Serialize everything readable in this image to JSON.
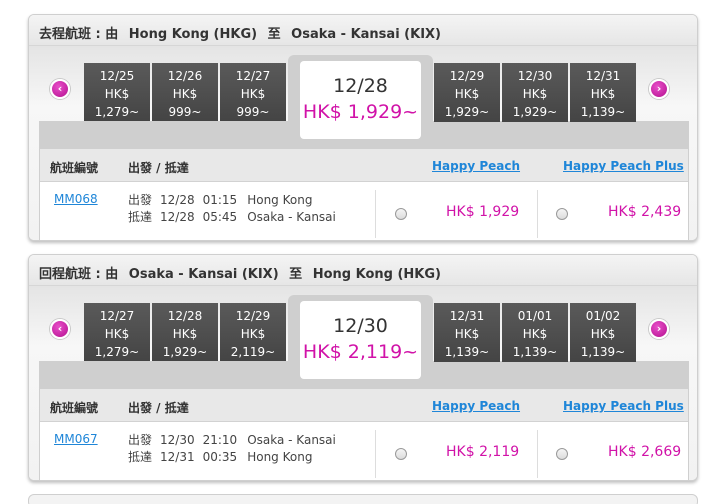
{
  "outbound": {
    "header": {
      "label": "去程航班 : 由",
      "from": "Hong Kong (HKG)",
      "to_word": "至",
      "to": "Osaka - Kansai (KIX)"
    },
    "dates": [
      {
        "date": "12/25",
        "currency": "HK$",
        "price": "1,279~"
      },
      {
        "date": "12/26",
        "currency": "HK$",
        "price": "999~"
      },
      {
        "date": "12/27",
        "currency": "HK$",
        "price": "999~"
      },
      {
        "date": "12/29",
        "currency": "HK$",
        "price": "1,929~"
      },
      {
        "date": "12/30",
        "currency": "HK$",
        "price": "1,929~"
      },
      {
        "date": "12/31",
        "currency": "HK$",
        "price": "1,139~"
      }
    ],
    "selected": {
      "date": "12/28",
      "price": "HK$ 1,929~"
    },
    "table": {
      "col_flight": "航班編號",
      "col_time": "出發 / 抵達",
      "col_hp": "Happy Peach",
      "col_hpp": "Happy Peach Plus"
    },
    "flight": {
      "number": "MM068",
      "dep_label": "出發",
      "dep_date": "12/28",
      "dep_time": "01:15",
      "dep_city": "Hong Kong",
      "arr_label": "抵達",
      "arr_date": "12/28",
      "arr_time": "05:45",
      "arr_city": "Osaka - Kansai",
      "price_hp": "HK$ 1,929",
      "price_hpp": "HK$ 2,439"
    }
  },
  "inbound": {
    "header": {
      "label": "回程航班 : 由",
      "from": "Osaka - Kansai (KIX)",
      "to_word": "至",
      "to": "Hong Kong (HKG)"
    },
    "dates": [
      {
        "date": "12/27",
        "currency": "HK$",
        "price": "1,279~"
      },
      {
        "date": "12/28",
        "currency": "HK$",
        "price": "1,929~"
      },
      {
        "date": "12/29",
        "currency": "HK$",
        "price": "2,119~"
      },
      {
        "date": "12/31",
        "currency": "HK$",
        "price": "1,139~"
      },
      {
        "date": "01/01",
        "currency": "HK$",
        "price": "1,139~"
      },
      {
        "date": "01/02",
        "currency": "HK$",
        "price": "1,139~"
      }
    ],
    "selected": {
      "date": "12/30",
      "price": "HK$ 2,119~"
    },
    "table": {
      "col_flight": "航班編號",
      "col_time": "出發 / 抵達",
      "col_hp": "Happy Peach",
      "col_hpp": "Happy Peach Plus"
    },
    "flight": {
      "number": "MM067",
      "dep_label": "出發",
      "dep_date": "12/30",
      "dep_time": "21:10",
      "dep_city": "Osaka - Kansai",
      "arr_label": "抵達",
      "arr_date": "12/31",
      "arr_time": "00:35",
      "arr_city": "Hong Kong",
      "price_hp": "HK$ 2,119",
      "price_hpp": "HK$ 2,669"
    }
  },
  "icons": {
    "prev": "chevron-left-icon",
    "next": "chevron-right-icon"
  },
  "colors": {
    "accent_pink": "#d112a8",
    "link_blue": "#1f86d8",
    "tile_dark": "#4a4a4a"
  }
}
